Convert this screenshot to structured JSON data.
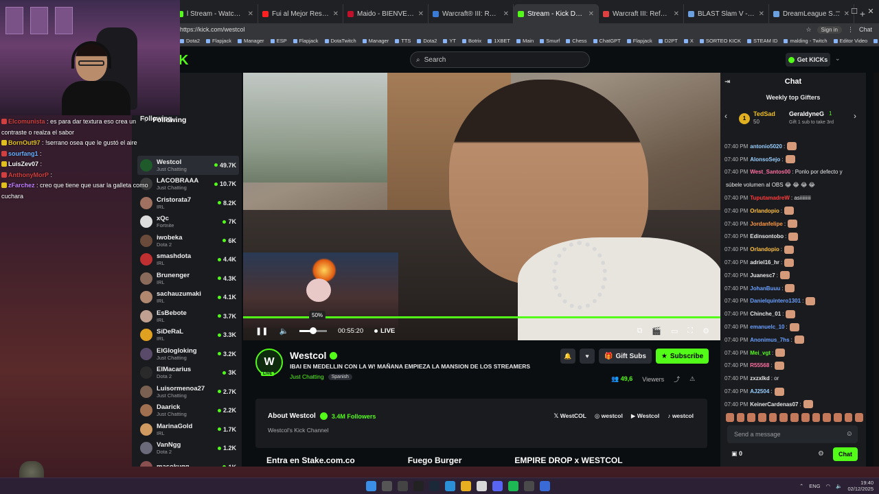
{
  "browser": {
    "tabs": [
      {
        "title": "l Stream - Watch Liv",
        "color": "#53fc18",
        "active": false
      },
      {
        "title": "Fui al Mejor Restaurante del Mu",
        "color": "#ff2020",
        "active": false
      },
      {
        "title": "Maido - BIENVENIDO A NUESTR",
        "color": "#c0102a",
        "active": false
      },
      {
        "title": "Warcraft® III: Reforged - Warcra",
        "color": "#3a7bd5",
        "active": false
      },
      {
        "title": "Stream - Kick Dashboard",
        "color": "#53fc18",
        "active": true
      },
      {
        "title": "Warcraft III: Reforged | Blizz Stor",
        "color": "#e04040",
        "active": false
      },
      {
        "title": "BLAST Slam V - Liquipedia Dota",
        "color": "#6aa0e0",
        "active": false
      },
      {
        "title": "DreamLeague Season 27 - Liqui",
        "color": "#6aa0e0",
        "active": false
      }
    ],
    "url": "https://kick.com/westcol",
    "signin": "Sign in",
    "chat_label": "Chat",
    "bookmarks": [
      "Dota2",
      "Flapjack",
      "Manager",
      "ESP",
      "Flapjack",
      "DotaTwitch",
      "Manager",
      "TTS",
      "Dota2",
      "YT",
      "Botrix",
      "1XBET",
      "Main",
      "Smurf",
      "Chess",
      "ChatGPT",
      "Flapjack",
      "D2PT",
      "X",
      "SORTEO KICK",
      "STEAM ID",
      "malding - Twitch",
      "Editor Video",
      "Framed"
    ]
  },
  "header": {
    "logo": "K",
    "search_placeholder": "Search",
    "get_kicks": "Get KICKs"
  },
  "sidebar": {
    "title": "Following",
    "section": "Following",
    "items": [
      {
        "name": "Westcol",
        "category": "Just Chatting",
        "viewers": "49.7K",
        "color": "#1f5a2a"
      },
      {
        "name": "LACOBRAAA",
        "category": "Just Chatting",
        "viewers": "10.7K",
        "color": "#3a3a3a"
      },
      {
        "name": "Cristorata7",
        "category": "IRL",
        "viewers": "8.2K",
        "color": "#a07060"
      },
      {
        "name": "xQc",
        "category": "Fortnite",
        "viewers": "7K",
        "color": "#dddddd"
      },
      {
        "name": "iwobeka",
        "category": "Dota 2",
        "viewers": "6K",
        "color": "#6a4a3a"
      },
      {
        "name": "smashdota",
        "category": "IRL",
        "viewers": "4.4K",
        "color": "#c03030"
      },
      {
        "name": "Brunenger",
        "category": "IRL",
        "viewers": "4.3K",
        "color": "#8a6a5a"
      },
      {
        "name": "sachauzumaki",
        "category": "IRL",
        "viewers": "4.1K",
        "color": "#b08870"
      },
      {
        "name": "EsBebote",
        "category": "IRL",
        "viewers": "3.7K",
        "color": "#c0a090"
      },
      {
        "name": "SiDeRaL",
        "category": "IRL",
        "viewers": "3.3K",
        "color": "#e0a020"
      },
      {
        "name": "ElGlogloking",
        "category": "Just Chatting",
        "viewers": "3.2K",
        "color": "#5a4a6a"
      },
      {
        "name": "ElMacarius",
        "category": "Dota 2",
        "viewers": "3K",
        "color": "#2a2a2a"
      },
      {
        "name": "Luisormenoa27",
        "category": "Just Chatting",
        "viewers": "2.7K",
        "color": "#7a6050"
      },
      {
        "name": "Daarick",
        "category": "Just Chatting",
        "viewers": "2.2K",
        "color": "#a07050"
      },
      {
        "name": "MarinaGold",
        "category": "IRL",
        "viewers": "1.7K",
        "color": "#d09a60"
      },
      {
        "name": "VanNgg",
        "category": "Dota 2",
        "viewers": "1.2K",
        "color": "#6a6a7a"
      },
      {
        "name": "masokugg",
        "category": "",
        "viewers": "1K",
        "color": "#8a5050"
      }
    ]
  },
  "player": {
    "volume_tooltip": "50%",
    "volume_level": 0.5,
    "timecode": "00:55:20",
    "live": "LIVE",
    "progress": 1.0
  },
  "stream": {
    "channel": "Westcol",
    "avatar_letter": "W",
    "live_badge": "LIVE",
    "title": "IBAI EN MEDELLIN  CON LA W! MAÑANA EMPIEZA LA MANSION DE LOS STREAMERS",
    "category": "Just Chatting",
    "language": "Spanish",
    "gift_subs": "Gift Subs",
    "subscribe": "Subscribe",
    "viewer_count": "49,6",
    "viewers_label": "Viewers"
  },
  "about": {
    "title": "About Westcol",
    "followers": "3.4M Followers",
    "description": "Westcol's Kick Channel",
    "socials": [
      "WestCOL",
      "westcol",
      "Westcol",
      "westcol"
    ],
    "panels": [
      "Entra en Stake.com.co",
      "Fuego Burger",
      "EMPIRE DROP x WESTCOL"
    ]
  },
  "chat": {
    "title": "Chat",
    "gifters_title": "Weekly top Gifters",
    "gifter1": {
      "rank": "1",
      "name": "TedSad",
      "count": "50"
    },
    "gifter2": {
      "name": "GeraldyneG",
      "count": "1"
    },
    "gift_hint": "Gift 1 sub to take 3rd",
    "messages": [
      {
        "time": "07:40 PM",
        "user": "antonio5020",
        "color": "#9ad0ff",
        "text": ":",
        "emote": true
      },
      {
        "time": "07:40 PM",
        "user": "AlonsoSejo",
        "color": "#9ad0ff",
        "text": ":",
        "emote": true
      },
      {
        "time": "07:40 PM",
        "user": "West_Santos00",
        "color": "#ff6fa0",
        "text": ": Ponlo por defecto y",
        "emote": false
      },
      {
        "time": "",
        "user": "",
        "color": "#e8e8e8",
        "text": "súbele volumen al OBS 😂 😂 😂 😂",
        "emote": false
      },
      {
        "time": "07:40 PM",
        "user": "TuputamadreW",
        "color": "#ff3a3a",
        "text": ": asiiiiiiiii",
        "emote": false
      },
      {
        "time": "07:40 PM",
        "user": "Orlandopio",
        "color": "#ffc040",
        "text": ":",
        "emote": true
      },
      {
        "time": "07:40 PM",
        "user": "Jordanfelipe",
        "color": "#ff9a40",
        "text": ":",
        "emote": true
      },
      {
        "time": "07:40 PM",
        "user": "Edinsontobo",
        "color": "#e8e8e8",
        "text": ":",
        "emote": true
      },
      {
        "time": "07:40 PM",
        "user": "Orlandopio",
        "color": "#ffc040",
        "text": ":",
        "emote": true
      },
      {
        "time": "07:40 PM",
        "user": "adriel16_hr",
        "color": "#e8e8e8",
        "text": ":",
        "emote": true
      },
      {
        "time": "07:40 PM",
        "user": "Juanesc7",
        "color": "#e8e8e8",
        "text": ":",
        "emote": true
      },
      {
        "time": "07:40 PM",
        "user": "JohanBuuu",
        "color": "#6aa0ff",
        "text": ":",
        "emote": true
      },
      {
        "time": "07:40 PM",
        "user": "Danielquintero1301",
        "color": "#6aa0ff",
        "text": ":",
        "emote": true
      },
      {
        "time": "07:40 PM",
        "user": "Chinche_01",
        "color": "#e8e8e8",
        "text": ":",
        "emote": true
      },
      {
        "time": "07:40 PM",
        "user": "emanuelc_10",
        "color": "#6aa0ff",
        "text": ":",
        "emote": true
      },
      {
        "time": "07:40 PM",
        "user": "Anonimus_7hs",
        "color": "#6aa0ff",
        "text": ":",
        "emote": true
      },
      {
        "time": "07:40 PM",
        "user": "Mei_vgt",
        "color": "#53fc18",
        "text": ":",
        "emote": true
      },
      {
        "time": "07:40 PM",
        "user": "R55568",
        "color": "#ff6fa0",
        "text": ":",
        "emote": true
      },
      {
        "time": "07:40 PM",
        "user": "zxzxlkd",
        "color": "#e8e8e8",
        "text": ": or",
        "emote": false
      },
      {
        "time": "07:40 PM",
        "user": "AJ2504",
        "color": "#9ad0ff",
        "text": ":",
        "emote": true
      },
      {
        "time": "07:40 PM",
        "user": "KeinerCardenas07",
        "color": "#e8e8e8",
        "text": ":",
        "emote": true
      }
    ],
    "input_placeholder": "Send a message",
    "points": "0",
    "send": "Chat"
  },
  "overlay": {
    "following": "Following",
    "lines": [
      {
        "user": "Elcomunista",
        "ucolor": "#d04040",
        "text": ": es para dar textura eso crea un contraste o realza el sabor"
      },
      {
        "user": "BornOut97",
        "ucolor": "#e0c020",
        "text": ": !serrano osea que le gustó el aire"
      },
      {
        "user": "sourfang1",
        "ucolor": "#6ab0ff",
        "text": ":"
      },
      {
        "user": "LuisZev07",
        "ucolor": "#ffffff",
        "text": ":"
      },
      {
        "user": "AnthonyMorP",
        "ucolor": "#d04040",
        "text": ":"
      },
      {
        "user": "zFarchez",
        "ucolor": "#c080ff",
        "text": ": creo que tiene que usar la galleta como cuchara"
      }
    ]
  },
  "taskbar": {
    "lang": "ENG",
    "time": "19:40",
    "date": "02/12/2025"
  }
}
